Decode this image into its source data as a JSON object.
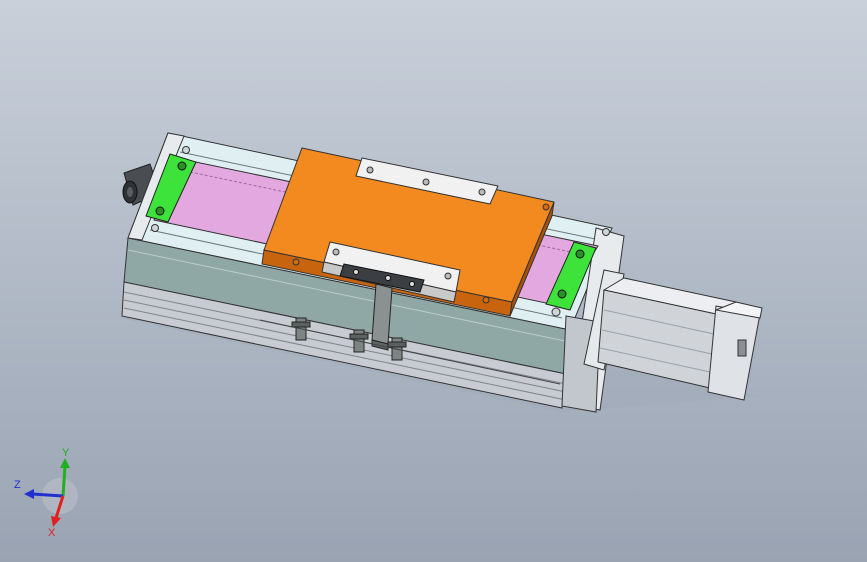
{
  "viewport": {
    "background_top": "#c9d0da",
    "background_bottom": "#99a3b2"
  },
  "model": {
    "components": [
      "base-frame",
      "end-cap-left",
      "end-cap-right",
      "cable-connector",
      "belt-cover",
      "carriage-plate",
      "carriage-bracket",
      "stopper-left",
      "stopper-right",
      "limit-sensors",
      "servo-motor"
    ],
    "colors": {
      "frame_top": "#dfeff2",
      "frame_side": "#8fa7a5",
      "frame_bottom": "#c8ccd2",
      "belt_cover": "#e2a8df",
      "carriage": "#f38a1f",
      "carriage_side": "#c8640e",
      "stopper": "#3de23a",
      "bracket": "#f1f1f1",
      "motor": "#d8dbe0",
      "connector": "#4a4e52"
    }
  },
  "triad": {
    "x_label": "X",
    "y_label": "Y",
    "z_label": "Z",
    "x_color": "#e02020",
    "y_color": "#20b020",
    "z_color": "#2030d0"
  }
}
